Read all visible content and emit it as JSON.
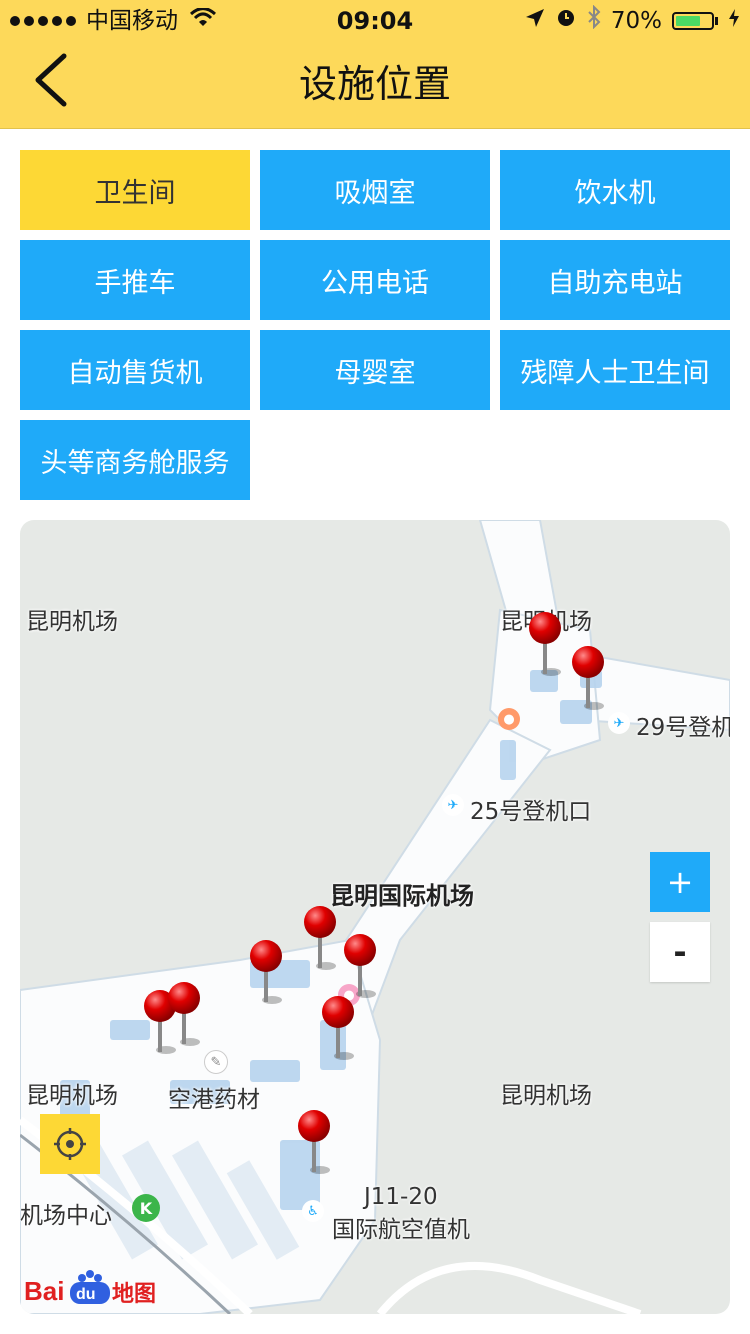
{
  "status_bar": {
    "carrier": "中国移动",
    "time": "09:04",
    "battery_percent": "70%",
    "battery_level": 0.7
  },
  "header": {
    "title": "设施位置",
    "back_icon": "chevron-left-icon"
  },
  "facilities": [
    {
      "label": "卫生间",
      "active": true
    },
    {
      "label": "吸烟室",
      "active": false
    },
    {
      "label": "饮水机",
      "active": false
    },
    {
      "label": "手推车",
      "active": false
    },
    {
      "label": "公用电话",
      "active": false
    },
    {
      "label": "自助充电站",
      "active": false
    },
    {
      "label": "自动售货机",
      "active": false
    },
    {
      "label": "母婴室",
      "active": false
    },
    {
      "label": "残障人士卫生间",
      "active": false
    },
    {
      "label": "头等商务舱服务",
      "active": false
    }
  ],
  "map": {
    "labels": {
      "kunming_airport_1": "昆明机场",
      "kunming_airport_2": "昆明机场",
      "kunming_airport_3": "昆明机场",
      "kunming_airport_4": "昆明机场",
      "gate_29": "29号登机",
      "gate_25": "25号登机口",
      "kunming_intl_airport": "昆明国际机场",
      "airport_pharmacy": "空港药材",
      "airport_center": "机场中心",
      "j11_20": "J11-20",
      "intl_checkin": "国际航空值机"
    },
    "zoom_in_label": "+",
    "zoom_out_label": "-",
    "logo_text": "地图",
    "pin_count": 9,
    "colors": {
      "accent_yellow": "#fdd835",
      "accent_blue": "#1faaf9",
      "pin_red": "#d50000"
    }
  }
}
